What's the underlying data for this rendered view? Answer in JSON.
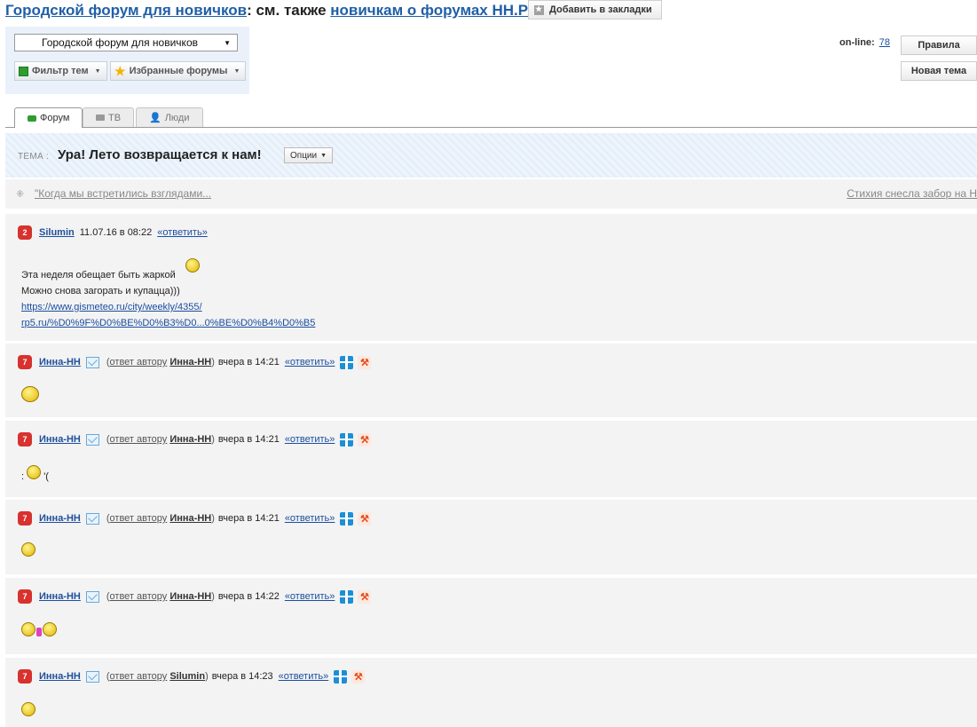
{
  "header": {
    "forum_link": "Городской форум для новичков",
    "see_also": ": см. также ",
    "newbies_link": "новичкам о форумах НН.РУ",
    "bookmark_btn": "Добавить в закладки"
  },
  "panel": {
    "forum_select": "Городской форум для новичков",
    "filter_btn": "Фильтр тем",
    "fav_btn": "Избранные форумы"
  },
  "online": {
    "label": "on-line:",
    "count": "78"
  },
  "buttons": {
    "rules": "Правила",
    "new_topic": "Новая тема"
  },
  "tabs": [
    {
      "label": "Форум",
      "icon": "chat-bubble-icon",
      "active": true
    },
    {
      "label": "ТВ",
      "icon": "camera-icon"
    },
    {
      "label": "Люди",
      "icon": "person-icon"
    }
  ],
  "topic": {
    "prefix": "ТЕМА :",
    "title": "Ура! Лето возвращается к нам!",
    "options_btn": "Опции"
  },
  "nav": {
    "prev": "\"Когда мы встретились взглядами...",
    "next": "Стихия снесла забор на Н"
  },
  "posts": [
    {
      "author": "Silumin",
      "avatar_badge": "2",
      "datetime": "11.07.16 в 08:22",
      "reply_link": "«ответить»",
      "lines": [
        "Эта неделя обещает быть жаркой",
        "Можно снова загорать и купацца)))"
      ],
      "links": [
        "https://www.gismeteo.ru/city/weekly/4355/",
        "rp5.ru/%D0%9F%D0%BE%D0%B3%D0...0%BE%D0%B4%D0%B5"
      ]
    },
    {
      "author": "Инна-НН",
      "reply_prefix": "ответ автору",
      "reply_author": "Инна-НН",
      "datetime": "вчера в 14:21",
      "reply_link": "«ответить»"
    },
    {
      "author": "Инна-НН",
      "reply_prefix": "ответ автору",
      "reply_author": "Инна-НН",
      "datetime": "вчера в 14:21",
      "reply_link": "«ответить»",
      "text_pre": ":",
      "text_post": "'("
    },
    {
      "author": "Инна-НН",
      "reply_prefix": "ответ автору",
      "reply_author": "Инна-НН",
      "datetime": "вчера в 14:21",
      "reply_link": "«ответить»"
    },
    {
      "author": "Инна-НН",
      "reply_prefix": "ответ автору",
      "reply_author": "Инна-НН",
      "datetime": "вчера в 14:22",
      "reply_link": "«ответить»"
    },
    {
      "author": "Инна-НН",
      "reply_prefix": "ответ автору",
      "reply_author": "Silumin",
      "datetime": "вчера в 14:23",
      "reply_link": "«ответить»"
    }
  ]
}
